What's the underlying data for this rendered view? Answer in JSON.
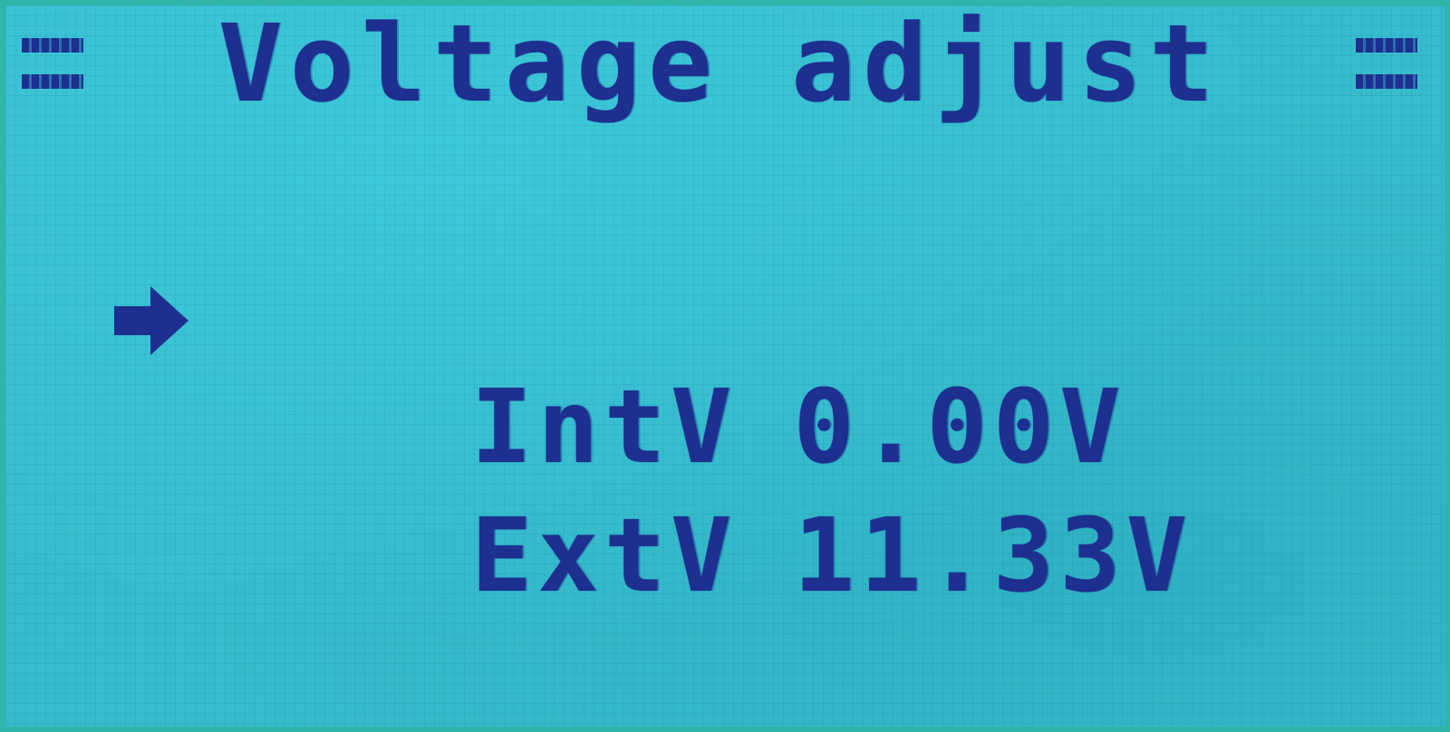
{
  "screen": {
    "title": "Voltage adjust",
    "accent_color": "#1d2f8f",
    "background_color": "#37bccd"
  },
  "menu": {
    "selected_index": 0,
    "cursor_icon": "arrow-right-icon",
    "items": [
      {
        "label": "IntV",
        "value": "0.00V"
      },
      {
        "label": "ExtV",
        "value": "11.33V"
      }
    ]
  }
}
